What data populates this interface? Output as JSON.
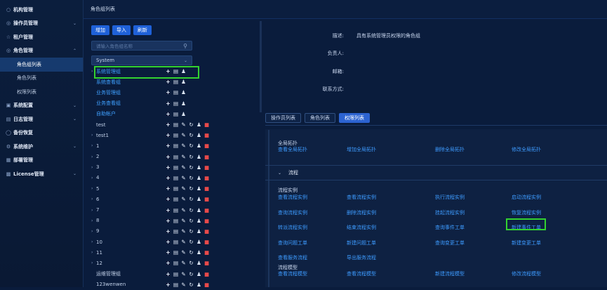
{
  "sidebar": {
    "items": [
      {
        "label": "机构管理",
        "icon": "org-icon",
        "expandable": false,
        "level": 1
      },
      {
        "label": "操作员管理",
        "icon": "operator-icon",
        "expandable": true,
        "level": 1
      },
      {
        "label": "租户管理",
        "icon": "tenant-icon",
        "expandable": false,
        "level": 1
      },
      {
        "label": "角色管理",
        "icon": "role-icon",
        "expandable": true,
        "expanded": true,
        "level": 1
      },
      {
        "label": "角色组列表",
        "icon": "",
        "level": 2,
        "active": true
      },
      {
        "label": "角色列表",
        "icon": "",
        "level": 2
      },
      {
        "label": "权限列表",
        "icon": "",
        "level": 2
      },
      {
        "label": "系统配置",
        "icon": "config-icon",
        "expandable": true,
        "level": 1
      },
      {
        "label": "日志管理",
        "icon": "log-icon",
        "expandable": true,
        "level": 1
      },
      {
        "label": "备份恢复",
        "icon": "backup-icon",
        "expandable": false,
        "level": 1
      },
      {
        "label": "系统维护",
        "icon": "maintenance-icon",
        "expandable": true,
        "level": 1
      },
      {
        "label": "部署管理",
        "icon": "deploy-icon",
        "expandable": false,
        "level": 1
      },
      {
        "label": "License管理",
        "icon": "license-icon",
        "expandable": true,
        "level": 1
      }
    ]
  },
  "page": {
    "title": "角色组列表"
  },
  "toolbar": {
    "add": "增加",
    "import": "导入",
    "refresh": "刷新"
  },
  "search": {
    "placeholder": "请输入角色组名称"
  },
  "system_select": {
    "value": "System"
  },
  "tree": [
    {
      "name": "系统管理组",
      "arrow": true,
      "blue": true,
      "actions": "basic"
    },
    {
      "name": "系统查看组",
      "arrow": false,
      "blue": true,
      "actions": "basic"
    },
    {
      "name": "业务管理组",
      "arrow": false,
      "blue": true,
      "actions": "basic"
    },
    {
      "name": "业务查看组",
      "arrow": false,
      "blue": true,
      "actions": "basic"
    },
    {
      "name": "自助帐户",
      "arrow": false,
      "blue": true,
      "actions": "basic"
    },
    {
      "name": "test",
      "arrow": false,
      "blue": false,
      "actions": "full"
    },
    {
      "name": "test1",
      "arrow": true,
      "blue": false,
      "actions": "full"
    },
    {
      "name": "1",
      "arrow": true,
      "blue": false,
      "actions": "full"
    },
    {
      "name": "2",
      "arrow": true,
      "blue": false,
      "actions": "full"
    },
    {
      "name": "3",
      "arrow": true,
      "blue": false,
      "actions": "full"
    },
    {
      "name": "4",
      "arrow": true,
      "blue": false,
      "actions": "full"
    },
    {
      "name": "5",
      "arrow": true,
      "blue": false,
      "actions": "full"
    },
    {
      "name": "6",
      "arrow": true,
      "blue": false,
      "actions": "full"
    },
    {
      "name": "7",
      "arrow": true,
      "blue": false,
      "actions": "full"
    },
    {
      "name": "8",
      "arrow": true,
      "blue": false,
      "actions": "full"
    },
    {
      "name": "9",
      "arrow": true,
      "blue": false,
      "actions": "full"
    },
    {
      "name": "10",
      "arrow": true,
      "blue": false,
      "actions": "full"
    },
    {
      "name": "11",
      "arrow": true,
      "blue": false,
      "actions": "full"
    },
    {
      "name": "12",
      "arrow": true,
      "blue": false,
      "actions": "full"
    },
    {
      "name": "运维管理组",
      "arrow": false,
      "blue": false,
      "actions": "full"
    },
    {
      "name": "123wenwen",
      "arrow": false,
      "blue": false,
      "actions": "full"
    }
  ],
  "info": {
    "description_label": "描述:",
    "description_value": "具有系统管理员权限的角色组",
    "owner_label": "负责人:",
    "owner_value": "",
    "email_label": "邮箱:",
    "email_value": "",
    "contact_label": "联系方式:",
    "contact_value": ""
  },
  "tabs": [
    {
      "label": "操作员列表",
      "active": false
    },
    {
      "label": "角色列表",
      "active": false
    },
    {
      "label": "权限列表",
      "active": true
    }
  ],
  "permissions": {
    "global_title": "全局拓扑",
    "global_items": [
      "查看全局拓扑",
      "增加全局拓扑",
      "删除全局拓扑",
      "修改全局拓扑"
    ],
    "process_header": "流程",
    "process_instance_title": "流程实例",
    "process_instance_items": [
      "查看流程实例",
      "查看流程实例",
      "执行流程实例",
      "启动流程实例",
      "查询流程实例",
      "删除流程实例",
      "挂起流程实例",
      "恢复流程实例",
      "转派流程实例",
      "结束流程实例",
      "查询事件工单",
      "新建事件工单",
      "查询问题工单",
      "新建问题工单",
      "查询变更工单",
      "新建变更工单",
      "查看服务流程",
      "导出服务流程"
    ],
    "process_model_title": "流程模型",
    "process_model_items": [
      "查看流程模型",
      "查看流程模型",
      "新建流程模型",
      "修改流程模型"
    ]
  },
  "colors": {
    "accent": "#2c63d1",
    "highlight": "#33d130",
    "link": "#3d9bff",
    "delete": "#e84a4a"
  }
}
